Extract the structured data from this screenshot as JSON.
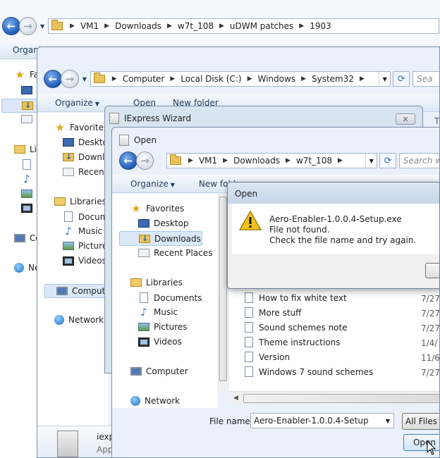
{
  "window1": {
    "breadcrumb": [
      "VM1",
      "Downloads",
      "w7t_108",
      "uDWM patches",
      "1903"
    ],
    "organize_partial": "Organi",
    "nav_partial": [
      "Fa",
      "Lil",
      "Co",
      "Ne"
    ]
  },
  "window2": {
    "breadcrumb": [
      "Computer",
      "Local Disk (C:)",
      "Windows",
      "System32"
    ],
    "search_partial": "Sea",
    "toolbar": {
      "organize": "Organize",
      "open": "Open",
      "new_folder": "New folder"
    },
    "nav": [
      {
        "label": "Favorites",
        "icon": "star-icon"
      },
      {
        "label": "Deskto",
        "icon": "desktop-icon"
      },
      {
        "label": "Downlo",
        "icon": "downloads-icon"
      },
      {
        "label": "Recent",
        "icon": "recent-places-icon"
      },
      {
        "label": "Libraries",
        "icon": "libraries-icon"
      },
      {
        "label": "Docum",
        "icon": "documents-icon"
      },
      {
        "label": "Music",
        "icon": "music-icon"
      },
      {
        "label": "Pictures",
        "icon": "pictures-icon"
      },
      {
        "label": "Videos",
        "icon": "videos-icon"
      },
      {
        "label": "Compute",
        "icon": "computer-icon"
      },
      {
        "label": "Network",
        "icon": "network-icon"
      }
    ],
    "details_name": "iexp",
    "details_type": "App",
    "col_t": "T"
  },
  "iexpress": {
    "title": "IExpress Wizard"
  },
  "open_dialog": {
    "title": "Open",
    "breadcrumb": [
      "VM1",
      "Downloads",
      "w7t_108"
    ],
    "search_placeholder": "Search w",
    "toolbar": {
      "organize": "Organize",
      "new_folder": "New fold"
    },
    "nav": [
      {
        "label": "Favorites",
        "icon": "star-icon"
      },
      {
        "label": "Desktop",
        "icon": "desktop-icon"
      },
      {
        "label": "Downloads",
        "icon": "downloads-icon"
      },
      {
        "label": "Recent Places",
        "icon": "recent-places-icon"
      },
      {
        "label": "Libraries",
        "icon": "libraries-icon"
      },
      {
        "label": "Documents",
        "icon": "documents-icon"
      },
      {
        "label": "Music",
        "icon": "music-icon"
      },
      {
        "label": "Pictures",
        "icon": "pictures-icon"
      },
      {
        "label": "Videos",
        "icon": "videos-icon"
      },
      {
        "label": "Computer",
        "icon": "computer-icon"
      },
      {
        "label": "Network",
        "icon": "network-icon"
      }
    ],
    "files": [
      {
        "name": "How to fix white text",
        "date": "7/27"
      },
      {
        "name": "More stuff",
        "date": "7/27"
      },
      {
        "name": "Sound schemes note",
        "date": "7/27"
      },
      {
        "name": "Theme instructions",
        "date": "1/4/"
      },
      {
        "name": "Version",
        "date": "11/6"
      },
      {
        "name": "Windows 7 sound schemes",
        "date": "7/27"
      }
    ],
    "file_name_label": "File name:",
    "file_name_value": "Aero-Enabler-1.0.0.4-Setup",
    "file_type": "All Files (*",
    "open_button": "Open"
  },
  "error_box": {
    "title": "Open",
    "line1": "Aero-Enabler-1.0.0.4-Setup.exe",
    "line2": "File not found.",
    "line3": "Check the file name and try again."
  }
}
